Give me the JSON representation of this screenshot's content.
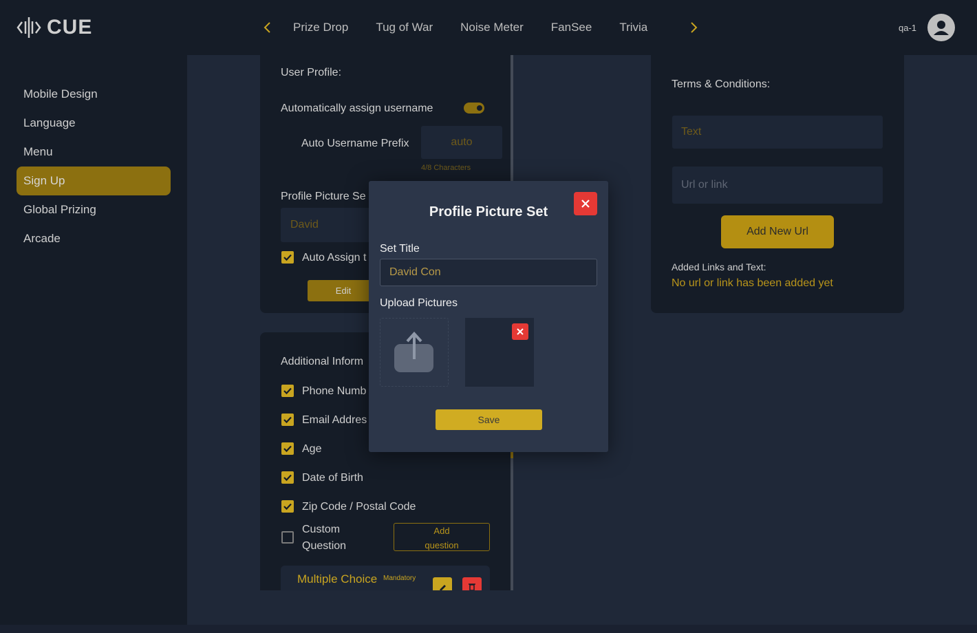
{
  "brand": {
    "name": "CUE"
  },
  "topnav": {
    "tabs": [
      "Prize Drop",
      "Tug of War",
      "Noise Meter",
      "FanSee",
      "Trivia"
    ],
    "user": "qa-1"
  },
  "sidebar": {
    "items": [
      {
        "label": "Mobile Design",
        "active": false
      },
      {
        "label": "Language",
        "active": false
      },
      {
        "label": "Menu",
        "active": false
      },
      {
        "label": "Sign Up",
        "active": true
      },
      {
        "label": "Global Prizing",
        "active": false
      },
      {
        "label": "Arcade",
        "active": false
      }
    ]
  },
  "user_profile": {
    "title": "User Profile:",
    "auto_assign_label": "Automatically assign username",
    "auto_assign_on": true,
    "prefix_label": "Auto Username Prefix",
    "prefix_value": "auto",
    "prefix_counter": "4/8 Characters",
    "picture_set_label": "Profile Picture Se",
    "picture_set_value": "David",
    "auto_assign_checkbox_label": "Auto Assign t",
    "edit_label": "Edit"
  },
  "additional_info": {
    "title": "Additional Inform",
    "fields": [
      {
        "label": "Phone Numb",
        "checked": true
      },
      {
        "label": "Email Addres",
        "checked": true
      },
      {
        "label": "Age",
        "checked": true
      },
      {
        "label": "Date of Birth",
        "checked": true
      },
      {
        "label": "Zip Code / Postal Code",
        "checked": true
      }
    ],
    "custom_question_line1": "Custom",
    "custom_question_line2": "Question",
    "add_question_line1": "Add",
    "add_question_line2": "question",
    "question_card_title": "Multiple Choice",
    "question_card_badge": "Mandatory"
  },
  "terms": {
    "title": "Terms & Conditions:",
    "text_placeholder": "Text",
    "url_placeholder": "Url or link",
    "add_url_label": "Add New Url",
    "added_label": "Added Links and Text:",
    "empty_message": "No url or link has been added yet"
  },
  "modal": {
    "title": "Profile Picture Set",
    "set_title_label": "Set Title",
    "set_title_value": "David Con",
    "upload_label": "Upload Pictures",
    "save_label": "Save"
  },
  "colors": {
    "accent": "#c9a520",
    "accent_dark": "#8c7010",
    "danger": "#e53935",
    "panel": "#151c27",
    "background": "#1f2838",
    "modal": "#2c3649"
  },
  "icons": [
    "logo-waveform-icon",
    "chevron-left-icon",
    "chevron-right-icon",
    "user-avatar-icon",
    "close-icon",
    "checkmark-icon",
    "upload-icon",
    "edit-pencil-icon",
    "trash-icon"
  ]
}
